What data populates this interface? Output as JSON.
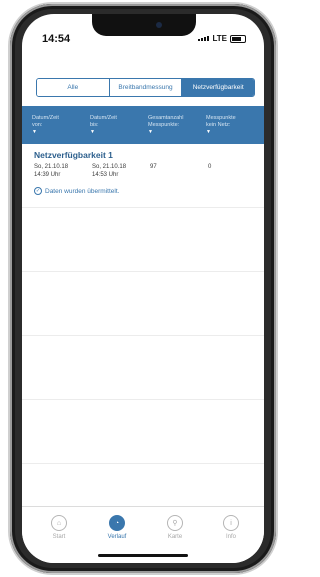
{
  "status_bar": {
    "time": "14:54",
    "network": "LTE"
  },
  "segments": [
    {
      "label": "Alle",
      "active": false
    },
    {
      "label": "Breitbandmessung",
      "active": false
    },
    {
      "label": "Netzverfügbarkeit",
      "active": true
    }
  ],
  "columns": [
    {
      "line1": "Datum/Zeit",
      "line2": "von:",
      "arrow": "▼"
    },
    {
      "line1": "Datum/Zeit",
      "line2": "bis:",
      "arrow": "▼"
    },
    {
      "line1": "Gesamtanzahl",
      "line2": "Messpunkte:",
      "arrow": "▼"
    },
    {
      "line1": "Messpunkte",
      "line2": "kein Netz:",
      "arrow": "▼"
    }
  ],
  "entry": {
    "title": "Netzverfügbarkeit 1",
    "from_date": "So, 21.10.18",
    "from_time": "14:39 Uhr",
    "to_date": "So, 21.10.18",
    "to_time": "14:53 Uhr",
    "total_points": "97",
    "no_network_points": "0",
    "status_message": "Daten wurden übermittelt."
  },
  "tabs": [
    {
      "label": "Start",
      "icon": "home-icon",
      "active": false
    },
    {
      "label": "Verlauf",
      "icon": "history-clock-icon",
      "active": true
    },
    {
      "label": "Karte",
      "icon": "map-pin-icon",
      "active": false
    },
    {
      "label": "Info",
      "icon": "info-icon",
      "active": false
    }
  ],
  "colors": {
    "accent": "#3a77ad",
    "entry_title": "#2c5f8d",
    "inactive_tab": "#a8a8a8"
  }
}
